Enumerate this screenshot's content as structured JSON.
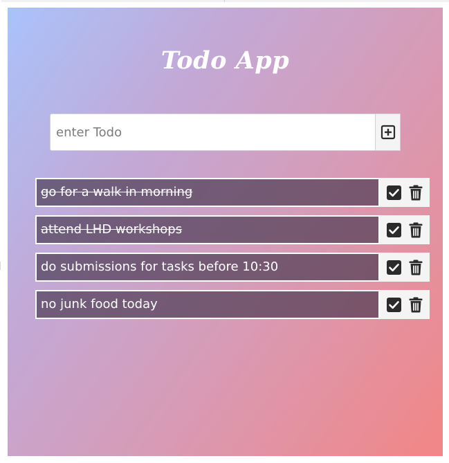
{
  "app": {
    "title": "Todo App"
  },
  "input": {
    "placeholder": "enter Todo",
    "value": ""
  },
  "todos": [
    {
      "text": "go for a walk in morning",
      "completed": true
    },
    {
      "text": "attend LHD workshops",
      "completed": true
    },
    {
      "text": "do submissions for tasks before 10:30",
      "completed": false
    },
    {
      "text": "no junk food today",
      "completed": false
    }
  ],
  "icons": {
    "add": "plus-square-icon",
    "complete": "check-square-icon",
    "delete": "trash-icon"
  },
  "colors": {
    "gradient_start": "#a9c3fb",
    "gradient_end": "#f28686",
    "item_background": "#55425f",
    "icon_color": "#2b2b2b"
  }
}
